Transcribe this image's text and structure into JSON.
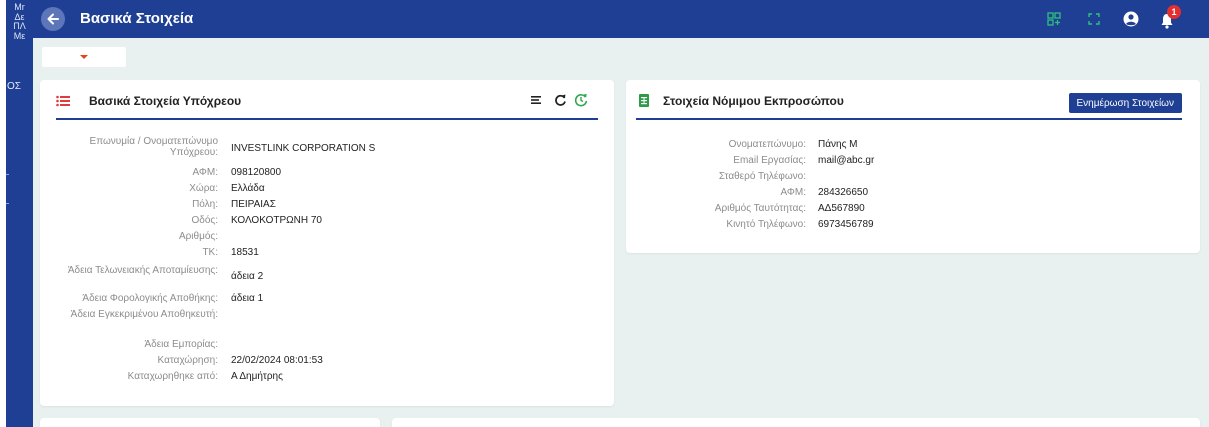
{
  "sidebar": {
    "items": [
      "Mr",
      "Δε",
      "ΠΛ",
      "Με"
    ],
    "section_label": "ΟΣ"
  },
  "header": {
    "title": "Βασικά Στοιχεία",
    "notification_count": "1",
    "icons": [
      "grid-add-icon",
      "fullscreen-icon",
      "user-account-icon",
      "bell-icon"
    ],
    "accent_color": "#1f3f94"
  },
  "left_card": {
    "title": "Βασικά Στοιχεία Υπόχρεου",
    "rows": [
      {
        "label": "Επωνυμία / Ονοματεπώνυμο Υπόχρεου:",
        "value": "INVESTLINK CORPORATION S"
      },
      {
        "label": "ΑΦΜ:",
        "value": "098120800"
      },
      {
        "label": "Χώρα:",
        "value": "Ελλάδα"
      },
      {
        "label": "Πόλη:",
        "value": "ΠΕΙΡΑΙΑΣ"
      },
      {
        "label": "Οδός:",
        "value": "ΚΟΛΟΚΟΤΡΩΝΗ 70"
      },
      {
        "label": "Αριθμός:",
        "value": ""
      },
      {
        "label": "ΤΚ:",
        "value": "18531"
      },
      {
        "label": "Άδεια Τελωνειακής Αποταμίευσης:",
        "value": "άδεια 2"
      },
      {
        "label": "Άδεια Φορολογικής Αποθήκης:",
        "value": "άδεια 1"
      },
      {
        "label": "Άδεια Εγκεκριμένου Αποθηκευτή:",
        "value": ""
      },
      {
        "label": "Άδεια Εμπορίας:",
        "value": ""
      },
      {
        "label": "Καταχώρηση:",
        "value": "22/02/2024 08:01:53"
      },
      {
        "label": "Καταχωρηθηκε από:",
        "value": "Α Δημήτρης"
      }
    ]
  },
  "right_card": {
    "title": "Στοιχεία Νόμιμου Εκπροσώπου",
    "update_button": "Ενημέρωση Στοιχείων",
    "rows": [
      {
        "label": "Ονοματεπώνυμο:",
        "value": "Πάνης Μ"
      },
      {
        "label": "Email Εργασίας:",
        "value": "mail@abc.gr"
      },
      {
        "label": "Σταθερό Τηλέφωνο:",
        "value": ""
      },
      {
        "label": "ΑΦΜ:",
        "value": "284326650"
      },
      {
        "label": "Αριθμός Ταυτότητας:",
        "value": "ΑΔ567890"
      },
      {
        "label": "Κινητό Τηλέφωνο:",
        "value": "6973456789"
      }
    ]
  }
}
